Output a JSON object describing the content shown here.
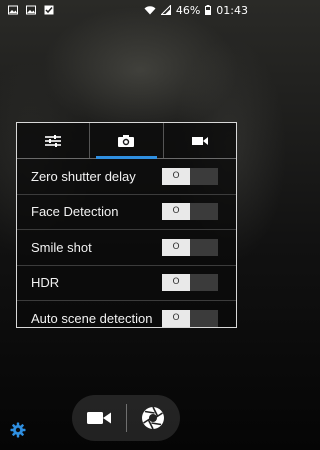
{
  "status_bar": {
    "battery": "46%",
    "time": "01:43",
    "icons": [
      "image-icon",
      "image-icon",
      "checkbox-icon",
      "wifi-icon",
      "signal-icon",
      "battery-icon"
    ]
  },
  "panel": {
    "tabs": [
      {
        "icon": "sliders-icon",
        "active": false
      },
      {
        "icon": "camera-icon",
        "active": true
      },
      {
        "icon": "video-icon",
        "active": false
      }
    ],
    "settings": [
      {
        "label": "Zero shutter delay",
        "state": "off"
      },
      {
        "label": "Face Detection",
        "state": "off"
      },
      {
        "label": "Smile shot",
        "state": "off"
      },
      {
        "label": "HDR",
        "state": "off"
      },
      {
        "label": "Auto scene detection",
        "state": "off"
      }
    ],
    "toggle_knob_symbol": "O"
  },
  "bottom_bar": {
    "left_icon": "video-record-icon",
    "right_icon": "shutter-icon"
  },
  "settings_icon": "gear-icon",
  "colors": {
    "accent": "#2f8fe0"
  }
}
